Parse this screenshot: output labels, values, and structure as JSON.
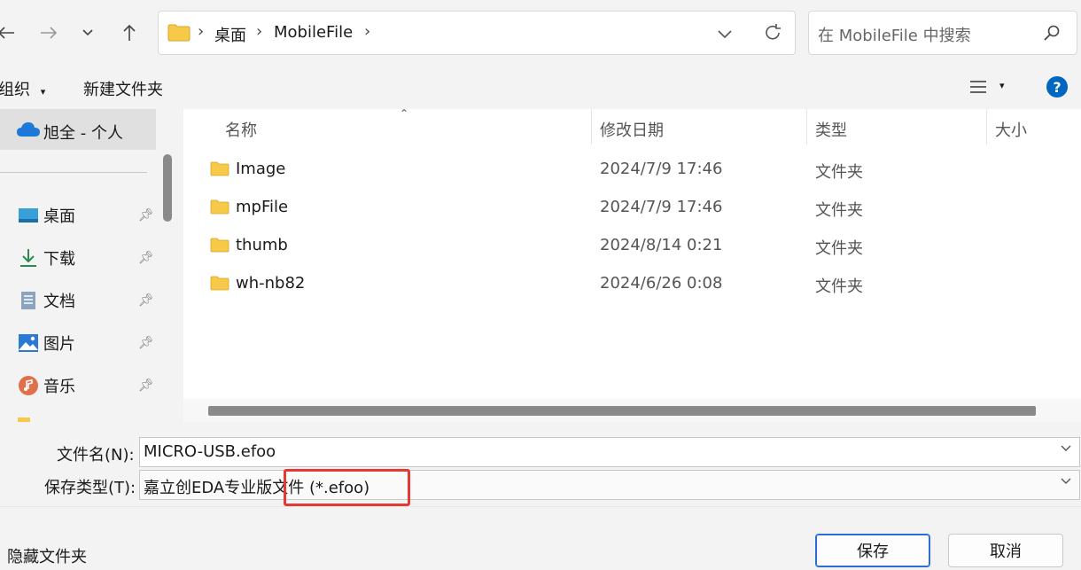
{
  "toolbar": {
    "breadcrumb": [
      "桌面",
      "MobileFile"
    ],
    "search_placeholder": "在 MobileFile 中搜索"
  },
  "command_bar": {
    "organize_label": "组织",
    "new_folder_label": "新建文件夹"
  },
  "nav": {
    "account_label": "旭全 - 个人",
    "items": [
      {
        "label": "桌面",
        "icon": "desktop-icon"
      },
      {
        "label": "下载",
        "icon": "download-icon"
      },
      {
        "label": "文档",
        "icon": "document-icon"
      },
      {
        "label": "图片",
        "icon": "pictures-icon"
      },
      {
        "label": "音乐",
        "icon": "music-icon"
      }
    ]
  },
  "list": {
    "columns": [
      "名称",
      "修改日期",
      "类型",
      "大小"
    ],
    "rows": [
      {
        "name": "Image",
        "date": "2024/7/9 17:46",
        "type": "文件夹"
      },
      {
        "name": "mpFile",
        "date": "2024/7/9 17:46",
        "type": "文件夹"
      },
      {
        "name": "thumb",
        "date": "2024/8/14 0:21",
        "type": "文件夹"
      },
      {
        "name": "wh-nb82",
        "date": "2024/6/26 0:08",
        "type": "文件夹"
      }
    ]
  },
  "form": {
    "filename_label": "文件名(N):",
    "filename_value": "MICRO-USB.efoo",
    "filetype_label": "保存类型(T):",
    "filetype_value": "嘉立创EDA专业版文件 (*.efoo)"
  },
  "footer": {
    "hide_folders_label": "隐藏文件夹",
    "save_label": "保存",
    "cancel_label": "取消"
  },
  "colors": {
    "accent": "#0067c0",
    "highlight_box": "#e53935",
    "folder_yellow": "#f7c948"
  }
}
